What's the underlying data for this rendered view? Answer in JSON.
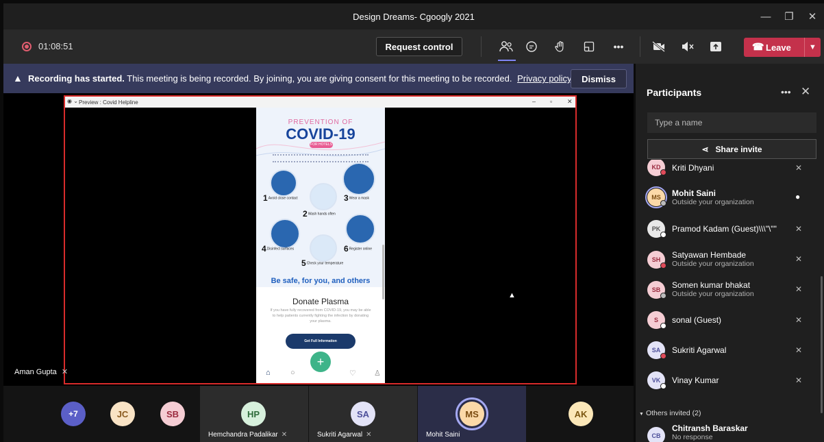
{
  "window": {
    "title": "Design Dreams- Cgoogly 2021",
    "controls": [
      "—",
      "❐",
      "✕"
    ]
  },
  "toolbar": {
    "timer": "01:08:51",
    "request_control": "Request control",
    "leave": "Leave",
    "icons": [
      "people-icon",
      "chat-icon",
      "raise-hand-icon",
      "rooms-icon",
      "more-icon",
      "camera-off-icon",
      "speaker-muted-icon",
      "share-tray-icon"
    ]
  },
  "banner": {
    "bold": "Recording has started.",
    "text": "This meeting is being recorded. By joining, you are giving consent for this meeting to be recorded.",
    "link": "Privacy policy",
    "dismiss": "Dismiss"
  },
  "shared_screen": {
    "window_title": "Preview : Covid Helpline",
    "poster": {
      "top": "PREVENTION OF",
      "title": "COVID-19",
      "pill": "FOR HOTELS",
      "steps": [
        {
          "num": "1",
          "text": "Avoid close contact"
        },
        {
          "num": "2",
          "text": "Wash hands often"
        },
        {
          "num": "3",
          "text": "Wear a mask"
        },
        {
          "num": "4",
          "text": "Disinfect surfaces"
        },
        {
          "num": "5",
          "text": "Check your temperature"
        },
        {
          "num": "6",
          "text": "Register online"
        }
      ],
      "slogan": "Be safe, for you, and others"
    },
    "donate_title": "Donate Plasma",
    "donate_text": "If you have fully recovered from COVID-19, you may be able to help patients currently fighting the infection by donating your plasma.",
    "get_info": "Get Full Information",
    "presenter": "Aman Gupta"
  },
  "gallery": {
    "overflow": "+7",
    "small": [
      {
        "initials": "JC",
        "bg": "#f9e3c5",
        "fg": "#8a5a1f"
      },
      {
        "initials": "SB",
        "bg": "#f5cdd4",
        "fg": "#9a2a3e"
      }
    ],
    "tiles": [
      {
        "initials": "HP",
        "name": "Hemchandra Padalikar",
        "bg": "#d7f0dc",
        "fg": "#2e6b3a"
      },
      {
        "initials": "SA",
        "name": "Sukriti Agarwal",
        "bg": "#e3e3f7",
        "fg": "#4d4f9a"
      },
      {
        "initials": "MS",
        "name": "Mohit Saini",
        "bg": "#fbd9a8",
        "fg": "#7a4b10"
      },
      {
        "initials": "AK",
        "name": "",
        "bg": "#fbe7b8",
        "fg": "#7a5510"
      }
    ]
  },
  "participants": {
    "title": "Participants",
    "search_placeholder": "Type a name",
    "share_invite": "Share invite",
    "people": [
      {
        "initials": "KD",
        "name": "Kriti Dhyani",
        "sub": "",
        "bg": "#f5cdd4",
        "fg": "#9a2a3e",
        "status": "#e04b5a",
        "mic": "muted"
      },
      {
        "initials": "MS",
        "name": "Mohit Saini",
        "sub": "Outside your organization",
        "bg": "#fbd9a8",
        "fg": "#7a4b10",
        "status": "#bbb",
        "mic": "on"
      },
      {
        "initials": "PK",
        "name": "Pramod Kadam (Guest)\\\\\\\"\\\"\"",
        "sub": "",
        "bg": "#e8e8e8",
        "fg": "#555",
        "status": "#fff",
        "mic": "muted"
      },
      {
        "initials": "SH",
        "name": "Satyawan Hembade",
        "sub": "Outside your organization",
        "bg": "#f5cdd4",
        "fg": "#9a2a3e",
        "status": "#e04b5a",
        "mic": "muted"
      },
      {
        "initials": "SB",
        "name": "Somen kumar bhakat",
        "sub": "Outside your organization",
        "bg": "#f5cdd4",
        "fg": "#9a2a3e",
        "status": "#bbb",
        "mic": "muted"
      },
      {
        "initials": "S",
        "name": "sonal (Guest)",
        "sub": "",
        "bg": "#f5cdd4",
        "fg": "#9a2a3e",
        "status": "#fff",
        "mic": "muted"
      },
      {
        "initials": "SA",
        "name": "Sukriti Agarwal",
        "sub": "",
        "bg": "#e3e3f7",
        "fg": "#4d4f9a",
        "status": "#e04b5a",
        "mic": "muted"
      },
      {
        "initials": "VK",
        "name": "Vinay Kumar",
        "sub": "",
        "bg": "#e3e3f7",
        "fg": "#4d4f9a",
        "status": "#fff",
        "mic": "muted"
      }
    ],
    "others_label": "Others invited (2)",
    "invited": [
      {
        "initials": "CB",
        "name": "Chitransh Baraskar",
        "sub": "No response",
        "bg": "#e3e3f7",
        "fg": "#4d4f9a"
      }
    ]
  }
}
